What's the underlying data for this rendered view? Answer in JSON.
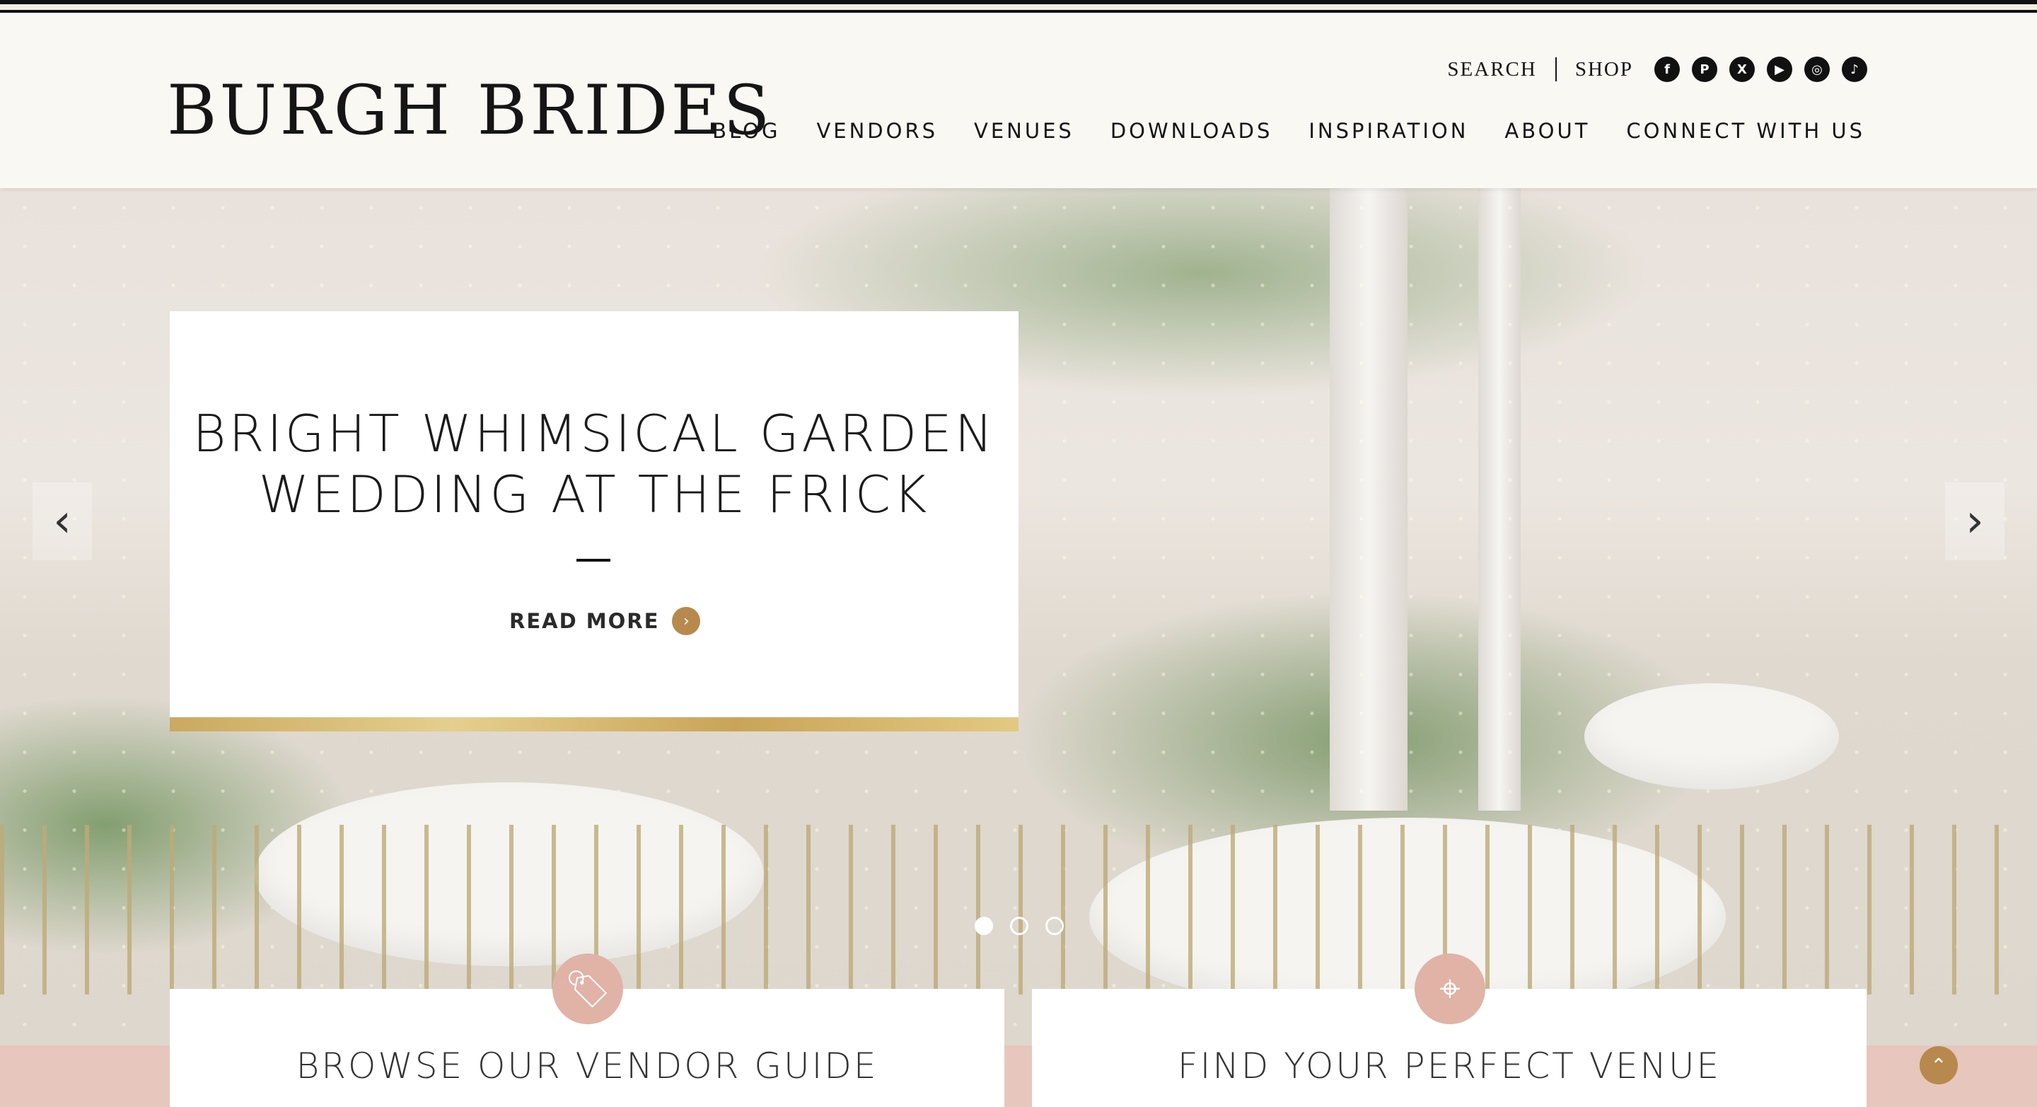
{
  "header": {
    "logo": "BURGH BRIDES",
    "utility": {
      "search": "SEARCH",
      "shop": "SHOP"
    },
    "socials": [
      {
        "icon": "facebook-icon",
        "glyph": "f"
      },
      {
        "icon": "pinterest-icon",
        "glyph": "P"
      },
      {
        "icon": "x-icon",
        "glyph": "X"
      },
      {
        "icon": "youtube-icon",
        "glyph": "▶"
      },
      {
        "icon": "instagram-icon",
        "glyph": "◎"
      },
      {
        "icon": "tiktok-icon",
        "glyph": "♪"
      }
    ],
    "nav": [
      "BLOG",
      "VENDORS",
      "VENUES",
      "DOWNLOADS",
      "INSPIRATION",
      "ABOUT",
      "CONNECT WITH US"
    ]
  },
  "hero": {
    "feature": {
      "title_line1": "BRIGHT WHIMSICAL GARDEN",
      "title_line2": "WEDDING AT THE FRICK",
      "read_more": "READ MORE"
    },
    "slide_count": 3,
    "active_slide": 1
  },
  "promos": [
    {
      "title": "BROWSE OUR VENDOR GUIDE",
      "icon": "tag-icon"
    },
    {
      "title": "FIND YOUR PERFECT VENUE",
      "icon": "location-pin-icon"
    }
  ],
  "colors": {
    "accent_gold": "#b8894d",
    "blush": "#e7c6bd",
    "promo_icon_bg": "#e0b3a6",
    "text_dark": "#151515"
  }
}
